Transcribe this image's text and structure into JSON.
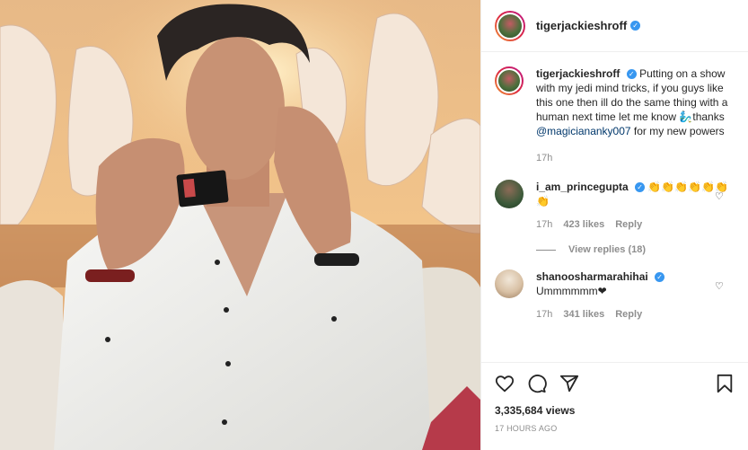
{
  "post": {
    "author": "tigerjackieshroff",
    "caption_before_mention": "Putting on a show with my jedi mind tricks, if you guys like this one then ill do the same thing with a human next time let me know ",
    "caption_emoji": "🧞‍♂️",
    "caption_thanks": "thanks ",
    "caption_mention": "@magiciananky007",
    "caption_after_mention": " for my new powers",
    "caption_time": "17h",
    "views": "3,335,684 views",
    "posted": "17 HOURS AGO"
  },
  "comments": [
    {
      "user": "i_am_princegupta",
      "text": "👏👏👏👏👏👏👏",
      "time": "17h",
      "likes": "423 likes",
      "reply": "Reply",
      "view_replies": "View replies (18)"
    },
    {
      "user": "shanoosharmarahihai",
      "text": "Ummmmmm❤",
      "time": "17h",
      "likes": "341 likes",
      "reply": "Reply"
    }
  ],
  "icons": {
    "like": "heart-icon",
    "comment": "comment-icon",
    "share": "share-icon",
    "save": "bookmark-icon",
    "verified": "verified-badge"
  },
  "colors": {
    "link": "#00376b",
    "verified": "#3897f0",
    "muted": "#8e8e8e"
  }
}
